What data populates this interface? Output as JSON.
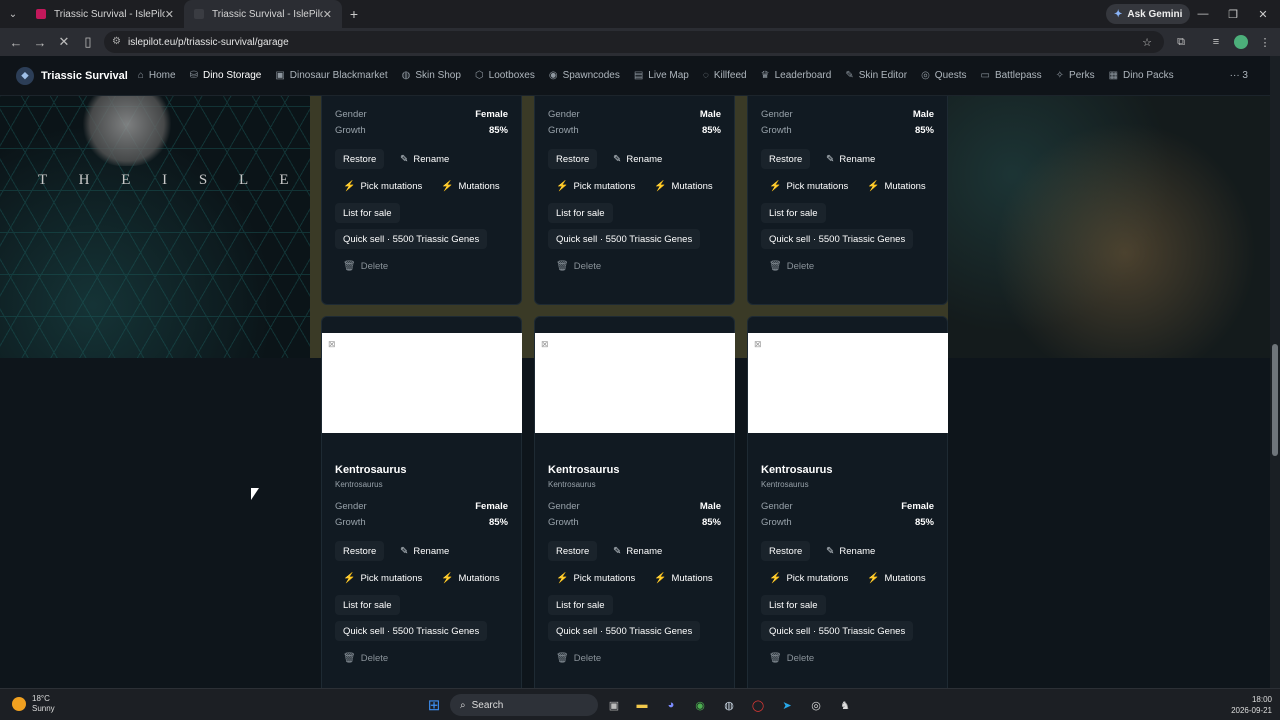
{
  "browser": {
    "tabs": [
      {
        "title": "Triassic Survival - IslePilot"
      },
      {
        "title": "Triassic Survival - IslePilot"
      }
    ],
    "new_tab": "+",
    "gemini_label": "Ask Gemini",
    "url": "islepilot.eu/p/triassic-survival/garage"
  },
  "site_nav": {
    "brand": "Triassic Survival",
    "items": [
      {
        "label": "Home",
        "icon": "home-icon"
      },
      {
        "label": "Dino Storage",
        "icon": "storage-icon"
      },
      {
        "label": "Dinosaur Blackmarket",
        "icon": "bag-icon"
      },
      {
        "label": "Skin Shop",
        "icon": "palette-icon"
      },
      {
        "label": "Lootboxes",
        "icon": "box-icon"
      },
      {
        "label": "Spawncodes",
        "icon": "pin-icon"
      },
      {
        "label": "Live Map",
        "icon": "map-icon"
      },
      {
        "label": "Killfeed",
        "icon": "skull-icon"
      },
      {
        "label": "Leaderboard",
        "icon": "trophy-icon"
      },
      {
        "label": "Skin Editor",
        "icon": "brush-icon"
      },
      {
        "label": "Quests",
        "icon": "target-icon"
      },
      {
        "label": "Battlepass",
        "icon": "ticket-icon"
      },
      {
        "label": "Perks",
        "icon": "sparkle-icon"
      },
      {
        "label": "Dino Packs",
        "icon": "pack-icon"
      }
    ],
    "more": "··· 3"
  },
  "banner_text": "T H E I S L E",
  "labels": {
    "gender": "Gender",
    "growth": "Growth",
    "restore": "Restore",
    "rename": "Rename",
    "pick_mutations": "Pick mutations",
    "mutations": "Mutations",
    "list_for_sale": "List for sale",
    "quick_sell": "Quick sell · 5500 Triassic Genes",
    "delete": "Delete"
  },
  "top_cards": [
    {
      "gender": "Female",
      "growth": "85%"
    },
    {
      "gender": "Male",
      "growth": "85%"
    },
    {
      "gender": "Male",
      "growth": "85%"
    }
  ],
  "cards": [
    {
      "name": "Kentrosaurus",
      "species": "Kentrosaurus",
      "gender": "Female",
      "growth": "85%"
    },
    {
      "name": "Kentrosaurus",
      "species": "Kentrosaurus",
      "gender": "Male",
      "growth": "85%"
    },
    {
      "name": "Kentrosaurus",
      "species": "Kentrosaurus",
      "gender": "Female",
      "growth": "85%"
    }
  ],
  "taskbar": {
    "temp": "18°C",
    "weather": "Sunny",
    "search": "Search",
    "time": "18:00",
    "date": "2026-09-21"
  }
}
